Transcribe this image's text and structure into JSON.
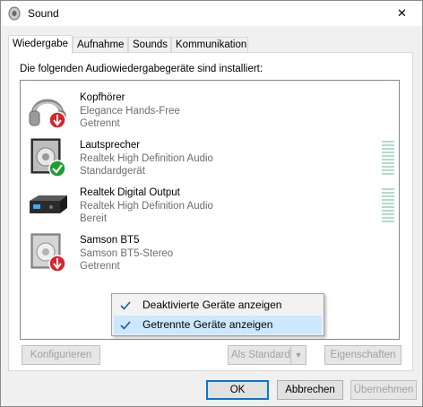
{
  "window": {
    "title": "Sound",
    "close_glyph": "✕"
  },
  "tabs": [
    {
      "label": "Wiedergabe"
    },
    {
      "label": "Aufnahme"
    },
    {
      "label": "Sounds"
    },
    {
      "label": "Kommunikation"
    }
  ],
  "instruction": "Die folgenden Audiowiedergabegeräte sind installiert:",
  "devices": [
    {
      "name": "Kopfhörer",
      "description": "Elegance Hands-Free",
      "status": "Getrennt",
      "icon": "headphones-icon",
      "badge": "disconnected-badge-icon"
    },
    {
      "name": "Lautsprecher",
      "description": "Realtek High Definition Audio",
      "status": "Standardgerät",
      "icon": "speaker-icon",
      "badge": "default-check-badge-icon"
    },
    {
      "name": "Realtek Digital Output",
      "description": "Realtek High Definition Audio",
      "status": "Bereit",
      "icon": "digital-output-icon",
      "badge": ""
    },
    {
      "name": "Samson BT5",
      "description": "Samson BT5-Stereo",
      "status": "Getrennt",
      "icon": "speaker-icon",
      "badge": "disconnected-badge-icon"
    }
  ],
  "context_menu": {
    "items": [
      {
        "label": "Deaktivierte Geräte anzeigen",
        "checked": true
      },
      {
        "label": "Getrennte Geräte anzeigen",
        "checked": true
      }
    ]
  },
  "panel_buttons": {
    "configure": "Konfigurieren",
    "set_default": "Als Standard",
    "properties": "Eigenschaften"
  },
  "dialog_buttons": {
    "ok": "OK",
    "cancel": "Abbrechen",
    "apply": "Übernehmen"
  },
  "colors": {
    "accent": "#0078d7",
    "disconnected_badge": "#d9242a",
    "default_badge": "#1f9e34",
    "menu_highlight": "#cce8ff",
    "vu_meter": "#b3dcc8"
  }
}
